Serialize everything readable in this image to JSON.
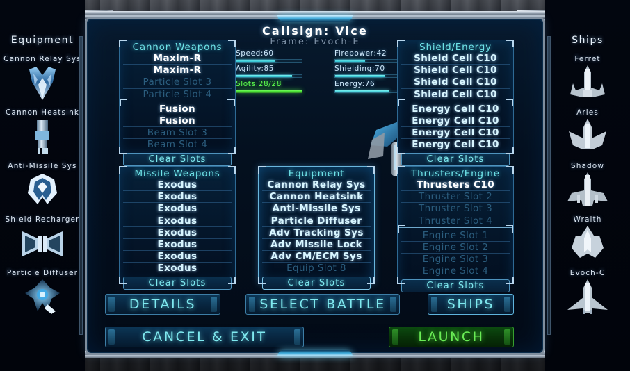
{
  "header": {
    "callsign_label": "Callsign: Vice",
    "frame_label": "Frame: Evoch-E"
  },
  "stats": [
    {
      "name": "speed",
      "label": "Speed:60",
      "value": 60,
      "color": "#2bbfcf"
    },
    {
      "name": "agility",
      "label": "Agility:85",
      "value": 85,
      "color": "#2bbfcf"
    },
    {
      "name": "slots",
      "label": "Slots:28/28",
      "value": 100,
      "color": "#22c312"
    },
    {
      "name": "firepower",
      "label": "Firepower:42",
      "value": 42,
      "color": "#2bbfcf"
    },
    {
      "name": "shielding",
      "label": "Shielding:70",
      "value": 70,
      "color": "#2bbfcf"
    },
    {
      "name": "energy",
      "label": "Energy:76",
      "value": 76,
      "color": "#2bbfcf"
    }
  ],
  "panels": {
    "cannon": {
      "title": "Cannon Weapons",
      "clear_label": "Clear Slots",
      "group_a": [
        {
          "label": "Maxim-R",
          "filled": true
        },
        {
          "label": "Maxim-R",
          "filled": true
        },
        {
          "label": "Particle Slot 3",
          "filled": false
        },
        {
          "label": "Particle Slot 4",
          "filled": false
        }
      ],
      "group_b": [
        {
          "label": "Fusion",
          "filled": true
        },
        {
          "label": "Fusion",
          "filled": true
        },
        {
          "label": "Beam Slot 3",
          "filled": false
        },
        {
          "label": "Beam Slot 4",
          "filled": false
        }
      ]
    },
    "shield": {
      "title": "Shield/Energy",
      "clear_label": "Clear Slots",
      "group_a": [
        {
          "label": "Shield Cell C10",
          "filled": true
        },
        {
          "label": "Shield Cell C10",
          "filled": true
        },
        {
          "label": "Shield Cell C10",
          "filled": true
        },
        {
          "label": "Shield Cell C10",
          "filled": true
        }
      ],
      "group_b": [
        {
          "label": "Energy Cell C10",
          "filled": true
        },
        {
          "label": "Energy Cell C10",
          "filled": true
        },
        {
          "label": "Energy Cell C10",
          "filled": true
        },
        {
          "label": "Energy Cell C10",
          "filled": true
        }
      ]
    },
    "missile": {
      "title": "Missile Weapons",
      "clear_label": "Clear Slots",
      "slots": [
        {
          "label": "Exodus",
          "filled": true
        },
        {
          "label": "Exodus",
          "filled": true
        },
        {
          "label": "Exodus",
          "filled": true
        },
        {
          "label": "Exodus",
          "filled": true
        },
        {
          "label": "Exodus",
          "filled": true
        },
        {
          "label": "Exodus",
          "filled": true
        },
        {
          "label": "Exodus",
          "filled": true
        },
        {
          "label": "Exodus",
          "filled": true
        }
      ]
    },
    "equipment": {
      "title": "Equipment",
      "clear_label": "Clear Slots",
      "slots": [
        {
          "label": "Cannon Relay Sys",
          "filled": true
        },
        {
          "label": "Cannon Heatsink",
          "filled": true
        },
        {
          "label": "Anti-Missile Sys",
          "filled": true
        },
        {
          "label": "Particle Diffuser",
          "filled": true
        },
        {
          "label": "Adv Tracking Sys",
          "filled": true
        },
        {
          "label": "Adv Missile Lock",
          "filled": true
        },
        {
          "label": "Adv CM/ECM Sys",
          "filled": true
        },
        {
          "label": "Equip Slot 8",
          "filled": false
        }
      ]
    },
    "thrusters": {
      "title": "Thrusters/Engine",
      "clear_label": "Clear Slots",
      "group_a": [
        {
          "label": "Thrusters C10",
          "filled": true
        },
        {
          "label": "Thruster Slot 2",
          "filled": false
        },
        {
          "label": "Thruster Slot 3",
          "filled": false
        },
        {
          "label": "Thruster Slot 4",
          "filled": false
        }
      ],
      "group_b": [
        {
          "label": "Engine Slot 1",
          "filled": false
        },
        {
          "label": "Engine Slot 2",
          "filled": false
        },
        {
          "label": "Engine Slot 3",
          "filled": false
        },
        {
          "label": "Engine Slot 4",
          "filled": false
        }
      ]
    }
  },
  "sidebar_left": {
    "title": "Equipment",
    "items": [
      {
        "label": "Cannon Relay Sys",
        "icon": "cannon-relay-thumb"
      },
      {
        "label": "Cannon Heatsink",
        "icon": "cannon-heatsink-thumb"
      },
      {
        "label": "Anti-Missile Sys",
        "icon": "anti-missile-thumb"
      },
      {
        "label": "Shield Recharger",
        "icon": "shield-recharger-thumb"
      },
      {
        "label": "Particle Diffuser",
        "icon": "particle-diffuser-thumb"
      }
    ]
  },
  "sidebar_right": {
    "title": "Ships",
    "items": [
      {
        "label": "Ferret",
        "icon": "ship-ferret-thumb"
      },
      {
        "label": "Aries",
        "icon": "ship-aries-thumb"
      },
      {
        "label": "Shadow",
        "icon": "ship-shadow-thumb"
      },
      {
        "label": "Wraith",
        "icon": "ship-wraith-thumb"
      },
      {
        "label": "Evoch-C",
        "icon": "ship-evoch-c-thumb"
      }
    ]
  },
  "buttons": {
    "details": "DETAILS",
    "select_battle": "SELECT BATTLE",
    "ships": "SHIPS",
    "cancel_exit": "CANCEL & EXIT",
    "launch": "LAUNCH"
  },
  "colors": {
    "cyan": "#7fe9ef",
    "green": "#69ec55",
    "panel_border": "#2e6a94",
    "empty_slot": "#2b5d7e"
  }
}
